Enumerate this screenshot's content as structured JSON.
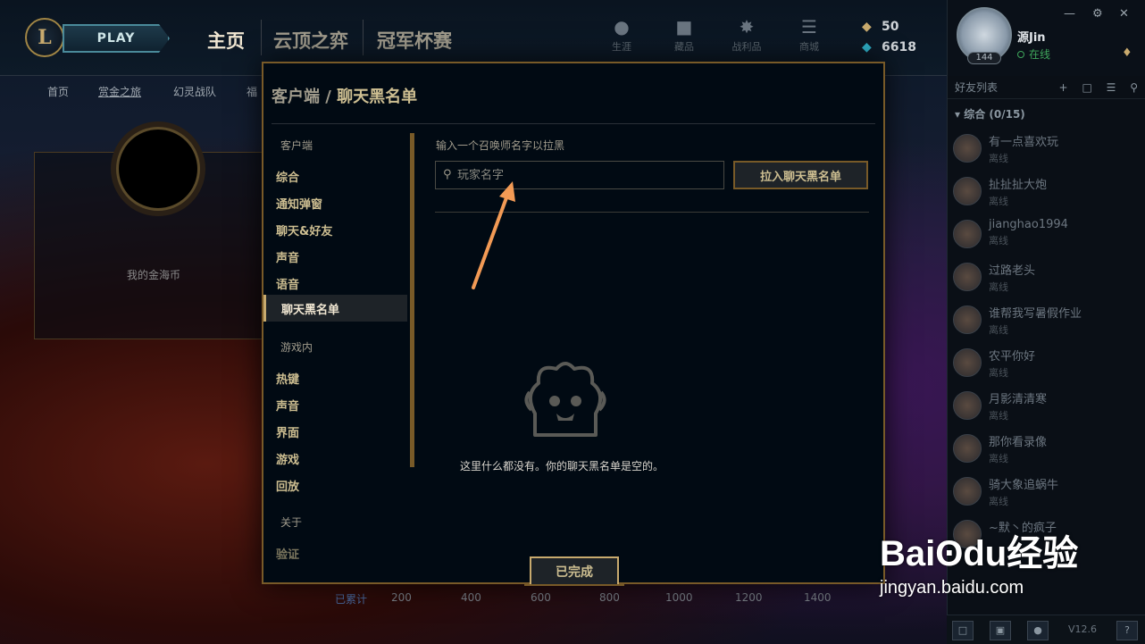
{
  "header": {
    "play_label": "PLAY",
    "nav": [
      "主页",
      "云顶之弈",
      "冠军杯赛"
    ],
    "icons": [
      {
        "name": "profile-icon",
        "label": "生涯"
      },
      {
        "name": "collection-icon",
        "label": "藏品"
      },
      {
        "name": "loot-icon",
        "label": "战利品"
      },
      {
        "name": "store-icon",
        "label": "商城"
      }
    ],
    "blue_essence": "50",
    "riot_points": "6618"
  },
  "profile": {
    "level": "144",
    "name": "源Jin",
    "status": "在线"
  },
  "subnav": [
    "首页",
    "赏金之旅",
    "幻灵战队",
    "福"
  ],
  "background": {
    "coin_label": "我的金海币",
    "axis_label": "已累计",
    "axis_ticks": [
      "200",
      "400",
      "600",
      "800",
      "1000",
      "1200",
      "1400"
    ]
  },
  "friends": {
    "title": "好友列表",
    "group": "综合 (0/15)",
    "items": [
      {
        "name": "有一点喜欢玩",
        "state": "离线"
      },
      {
        "name": "扯扯扯大炮",
        "state": "离线"
      },
      {
        "name": "jianghao1994",
        "state": "离线"
      },
      {
        "name": "过路老头",
        "state": "离线"
      },
      {
        "name": "谁帮我写暑假作业",
        "state": "离线"
      },
      {
        "name": "农平你好",
        "state": "离线"
      },
      {
        "name": "月影清清寒",
        "state": "离线"
      },
      {
        "name": "那你看录像",
        "state": "离线"
      },
      {
        "name": "骑大象追蜗牛",
        "state": "离线"
      },
      {
        "name": "~默丶的疯子",
        "state": ""
      }
    ]
  },
  "modal": {
    "breadcrumb_parent": "客户端",
    "breadcrumb_sep": "/",
    "breadcrumb_current": "聊天黑名单",
    "client_section": "客户端",
    "client_items": [
      "综合",
      "通知弹窗",
      "聊天&好友",
      "声音",
      "语音"
    ],
    "active_item": "聊天黑名单",
    "ingame_section": "游戏内",
    "ingame_items": [
      "热键",
      "声音",
      "界面",
      "游戏",
      "回放"
    ],
    "about_section": "关于",
    "about_items": [
      "验证"
    ],
    "input_label": "输入一个召唤师名字以拉黑",
    "search_placeholder": "玩家名字",
    "add_button": "拉入聊天黑名单",
    "empty_text": "这里什么都没有。你的聊天黑名单是空的。",
    "done_button": "已完成"
  },
  "version": "V12.6",
  "watermark": {
    "brand": "Baiʘdu经验",
    "url": "jingyan.baidu.com"
  },
  "colors": {
    "gold": "#c8aa6e",
    "gold_dark": "#785a28",
    "text_gold": "#cdbe91",
    "online_green": "#3fa65c",
    "arrow_orange": "#f29a55"
  }
}
